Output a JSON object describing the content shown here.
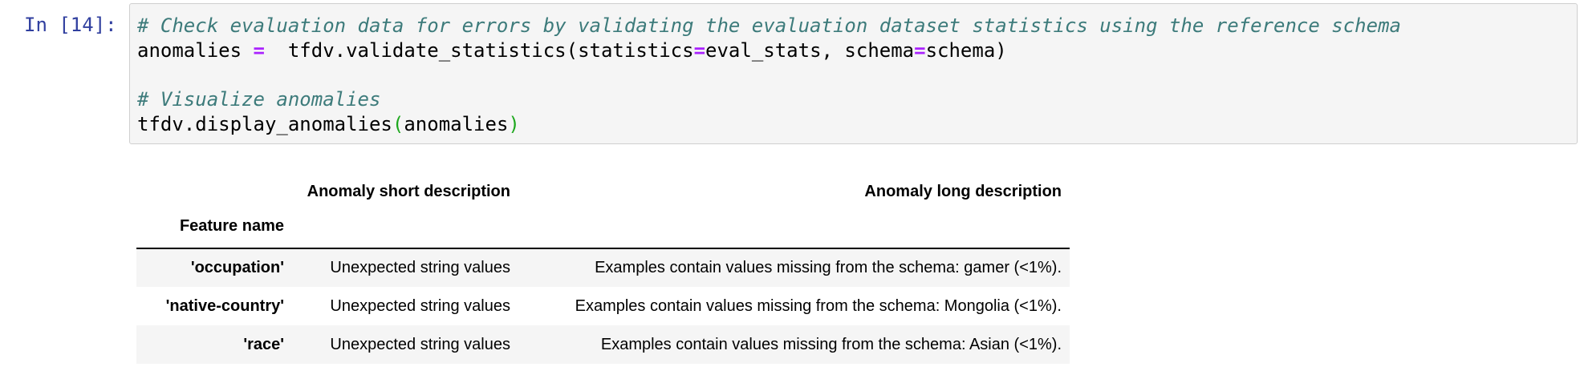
{
  "cell": {
    "prompt": "In [14]:",
    "code_lines": [
      [
        {
          "text": "# Check evaluation data for errors by validating the evaluation dataset statistics using the reference schema",
          "kind": "comment"
        }
      ],
      [
        {
          "text": "anomalies ",
          "kind": "plain"
        },
        {
          "text": "=",
          "kind": "op"
        },
        {
          "text": "  tfdv.validate_statistics(statistics",
          "kind": "plain"
        },
        {
          "text": "=",
          "kind": "op"
        },
        {
          "text": "eval_stats, schema",
          "kind": "plain"
        },
        {
          "text": "=",
          "kind": "op"
        },
        {
          "text": "schema)",
          "kind": "plain"
        }
      ],
      [],
      [
        {
          "text": "# Visualize anomalies",
          "kind": "comment"
        }
      ],
      [
        {
          "text": "tfdv.display_anomalies",
          "kind": "plain"
        },
        {
          "text": "(",
          "kind": "paren"
        },
        {
          "text": "anomalies",
          "kind": "plain"
        },
        {
          "text": ")",
          "kind": "paren"
        }
      ]
    ]
  },
  "output": {
    "columns": [
      "Anomaly short description",
      "Anomaly long description"
    ],
    "index_name": "Feature name",
    "rows": [
      {
        "feature": "'occupation'",
        "short": "Unexpected string values",
        "long": "Examples contain values missing from the schema: gamer (<1%)."
      },
      {
        "feature": "'native-country'",
        "short": "Unexpected string values",
        "long": "Examples contain values missing from the schema: Mongolia (<1%)."
      },
      {
        "feature": "'race'",
        "short": "Unexpected string values",
        "long": "Examples contain values missing from the schema: Asian (<1%)."
      }
    ]
  },
  "colors": {
    "prompt": "#303f9f",
    "comment": "#3d7b7b",
    "operator": "#aa22ff",
    "paren": "#1ea81e",
    "code_background": "#f5f5f5",
    "stripe": "#f5f5f5"
  }
}
